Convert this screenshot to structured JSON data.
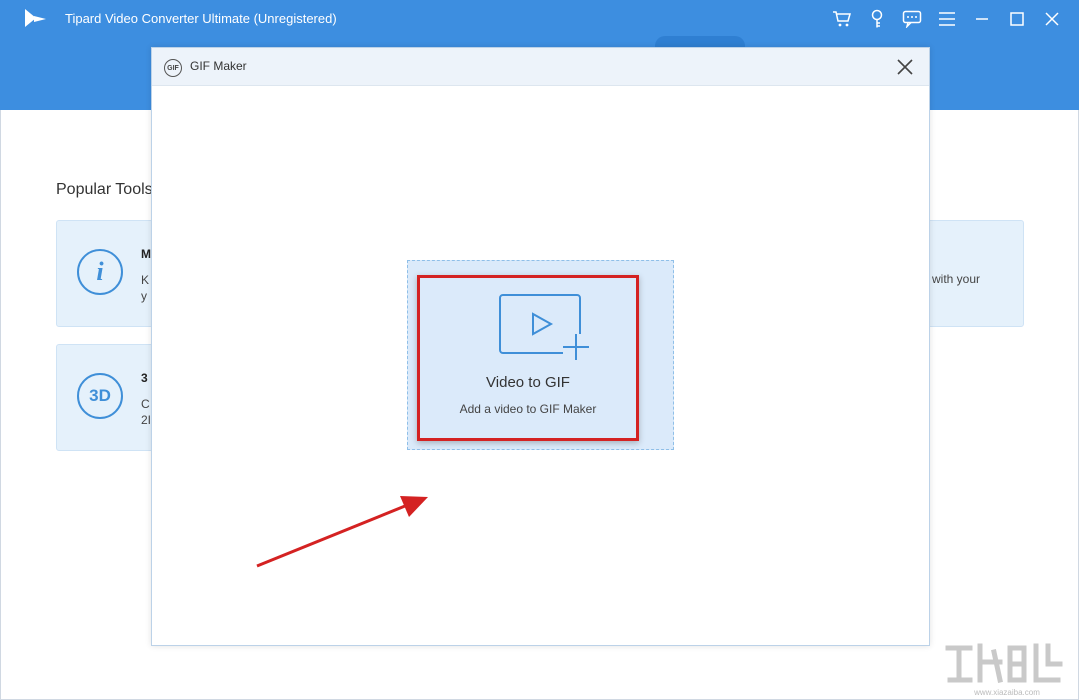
{
  "app": {
    "title": "Tipard Video Converter Ultimate (Unregistered)",
    "accent_color": "#3d8ee0",
    "titlebar_icons": [
      "cart-icon",
      "key-icon",
      "feedback-icon",
      "menu-icon",
      "minimize-icon",
      "maximize-icon",
      "close-icon"
    ]
  },
  "main": {
    "section_title": "Popular Tools",
    "tools": [
      {
        "icon_text": "i",
        "name": "M",
        "desc_line1": "K",
        "desc_line2": "y"
      },
      {
        "icon_text": "3D",
        "name": "3",
        "desc_line1": "C",
        "desc_line2": "2I"
      }
    ],
    "right_card_desc": "with your"
  },
  "dialog": {
    "title": "GIF Maker",
    "icon_text": "GIF",
    "add_tile": {
      "label": "Video to GIF",
      "sub_label": "Add a video to GIF Maker"
    }
  },
  "annotation": {
    "color": "#d42222"
  },
  "watermark": {
    "site": "www.xiazaiba.com"
  }
}
